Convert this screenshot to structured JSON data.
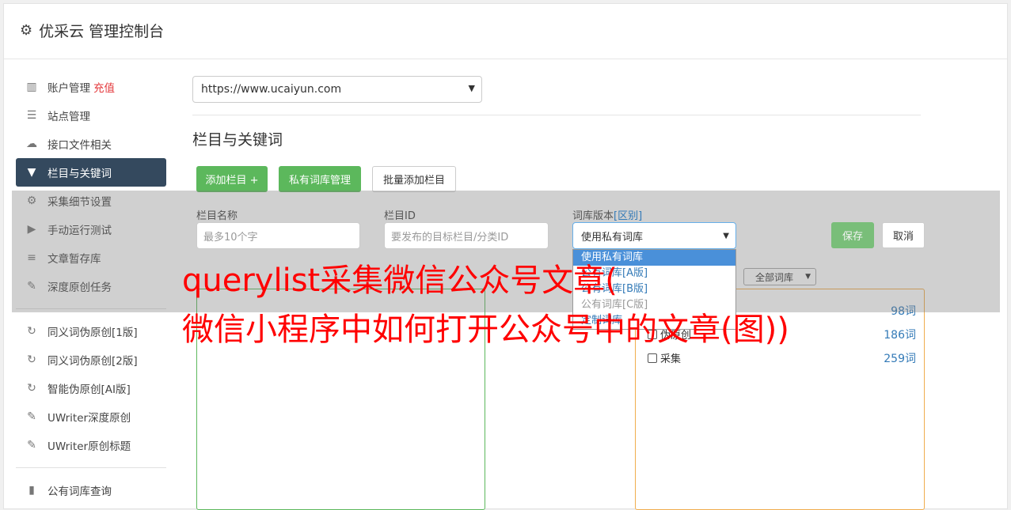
{
  "header": {
    "icon": "gear-icon",
    "title": "优采云 管理控制台"
  },
  "sidebar": {
    "items": [
      {
        "icon": "bar-chart-icon",
        "label": "账户管理",
        "badge": "充值"
      },
      {
        "icon": "server-icon",
        "label": "站点管理"
      },
      {
        "icon": "cloud-upload-icon",
        "label": "接口文件相关"
      },
      {
        "icon": "filter-icon",
        "label": "栏目与关键词",
        "active": true
      },
      {
        "icon": "cogs-icon",
        "label": "采集细节设置"
      },
      {
        "icon": "play-circle-icon",
        "label": "手动运行测试"
      },
      {
        "icon": "database-icon",
        "label": "文章暂存库"
      },
      {
        "icon": "edit-icon",
        "label": "深度原创任务"
      },
      {
        "icon": "refresh-icon",
        "label": "同义词伪原创[1版]"
      },
      {
        "icon": "refresh-icon",
        "label": "同义词伪原创[2版]"
      },
      {
        "icon": "refresh-icon",
        "label": "智能伪原创[AI版]"
      },
      {
        "icon": "edit-icon",
        "label": "UWriter深度原创"
      },
      {
        "icon": "edit-icon",
        "label": "UWriter原创标题"
      },
      {
        "icon": "book-icon",
        "label": "公有词库查询"
      }
    ]
  },
  "main": {
    "site_select": "https://www.ucaiyun.com",
    "section_title": "栏目与关键词",
    "buttons": {
      "add_column": "添加栏目 +",
      "private_lib": "私有词库管理",
      "batch_add": "批量添加栏目",
      "save": "保存",
      "cancel": "取消"
    },
    "form": {
      "name_label": "栏目名称",
      "name_placeholder": "最多10个字",
      "id_label": "栏目ID",
      "id_placeholder": "要发布的目标栏目/分类ID",
      "version_label": "词库版本",
      "version_link": "[区别]",
      "version_value": "使用私有词库"
    },
    "dropdown_options": [
      "使用私有词库",
      "公有词库[A版]",
      "公有词库[B版]",
      "公有词库[C版]",
      "定制词库"
    ],
    "library_filter": "全部词库",
    "libraries": [
      {
        "name": "",
        "count": "98词"
      },
      {
        "name": "伪原创",
        "count": "186词"
      },
      {
        "name": "采集",
        "count": "259词"
      }
    ]
  },
  "watermark": {
    "line1": "querylist采集微信公众号文章(",
    "line2": "微信小程序中如何打开公众号中的文章(图))"
  }
}
